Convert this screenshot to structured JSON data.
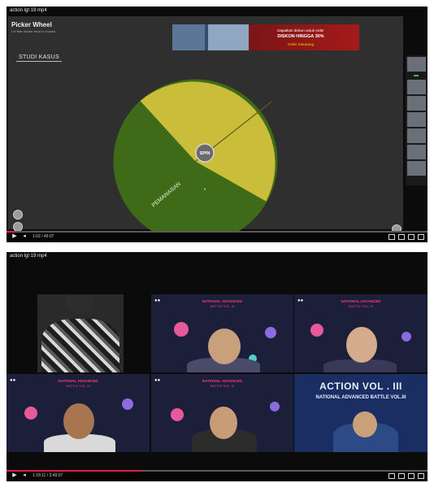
{
  "top_player": {
    "video_title": "action lgt 19 mp4",
    "app": {
      "title": "Picker Wheel",
      "subtitle": "Let fate decide what to choose"
    },
    "tag_button": "STUDI KASUS",
    "ad": {
      "line1": "Dapatkan diskon untuk order",
      "line2": "DISKON HINGGA 30%",
      "line3": "Order Sekarang"
    },
    "wheel": {
      "center_label": "SPIN",
      "segments": [
        {
          "label": "",
          "color": "#c9bd3a"
        },
        {
          "label": "PEMANASAN",
          "color": "#3f6a18"
        }
      ],
      "pointer_label": "",
      "dot": "•"
    },
    "controls": {
      "time": "1:02 / 49:07",
      "progress": 0.02,
      "play_icon": "play-icon",
      "next_icon": "skip-icon"
    }
  },
  "bottom_player": {
    "video_title": "action lgt 19 mp4",
    "tiles": [
      {
        "header": "",
        "header2": "",
        "caption": ""
      },
      {
        "header": "NATIONAL ADVANCED",
        "header2": "BATTLE VOL. III",
        "caption": ""
      },
      {
        "header": "NATIONAL ADVANCED",
        "header2": "BATTLE VOL. III",
        "caption": ""
      },
      {
        "header": "NATIONAL ADVANCED",
        "header2": "BATTLE VOL. III",
        "caption": ""
      },
      {
        "header": "NATIONAL ADVANCED",
        "header2": "BATTLE VOL. III",
        "caption": ""
      },
      {
        "header": "ACTION VOL . III",
        "header2": "NATIONAL ADVANCED BATTLE VOL.III",
        "caption": ""
      }
    ],
    "controls": {
      "time": "1:18:11 / 3:49:07",
      "progress": 0.32
    }
  }
}
